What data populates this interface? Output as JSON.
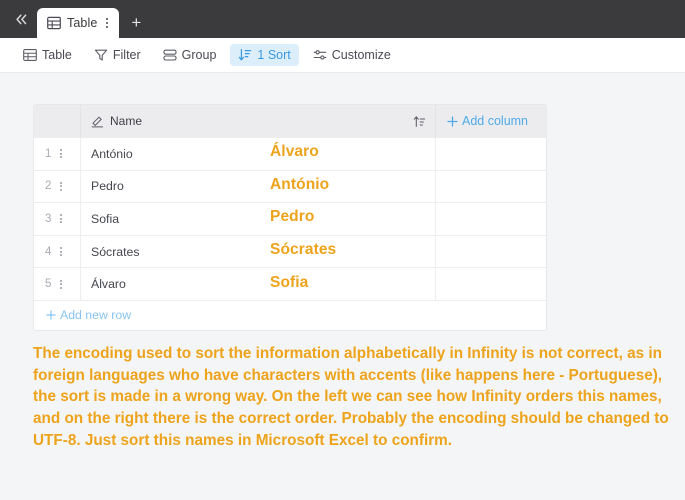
{
  "topbar": {
    "collapse_icon": "chevrons-left-icon",
    "tab": {
      "icon": "table-grid-icon",
      "label": "Table",
      "menu_icon": "kebab-menu-icon"
    },
    "new_tab_label": "+"
  },
  "toolbar": {
    "items": [
      {
        "label": "Table",
        "icon": "table-grid-icon",
        "active": false
      },
      {
        "label": "Filter",
        "icon": "funnel-icon",
        "active": false
      },
      {
        "label": "Group",
        "icon": "group-rows-icon",
        "active": false
      },
      {
        "label": "1 Sort",
        "icon": "sort-down-icon",
        "active": true
      },
      {
        "label": "Customize",
        "icon": "sliders-icon",
        "active": false
      }
    ]
  },
  "table": {
    "header": {
      "name_icon": "text-field-pencil-icon",
      "name_label": "Name",
      "sort_indicator_icon": "sort-ascending-icon",
      "add_column_icon": "plus-icon",
      "add_column_label": "Add column"
    },
    "rows": [
      {
        "num": "1",
        "name": "António"
      },
      {
        "num": "2",
        "name": "Pedro"
      },
      {
        "num": "3",
        "name": "Sofia"
      },
      {
        "num": "4",
        "name": "Sócrates"
      },
      {
        "num": "5",
        "name": "Álvaro"
      }
    ],
    "add_row_icon": "plus-icon",
    "add_row_label": "Add new row"
  },
  "correct_order": {
    "items": [
      "Álvaro",
      "António",
      "Pedro",
      "Sócrates",
      "Sofia"
    ]
  },
  "annotation": {
    "text": "The encoding used to sort the information alphabetically in Infinity is not correct, as in foreign languages who have characters with accents (like happens here - Portuguese), the sort is made in a wrong way. On the left we can see how Infinity orders this names, and on the right there is the correct order. Probably the encoding should be changed to UTF-8. Just sort this names in Microsoft Excel to confirm."
  },
  "colors": {
    "accent_blue": "#3a9ae0",
    "annotation_orange": "#eda31b",
    "topbar_dark": "#3b3b3d",
    "page_bg": "#f4f5f6"
  }
}
